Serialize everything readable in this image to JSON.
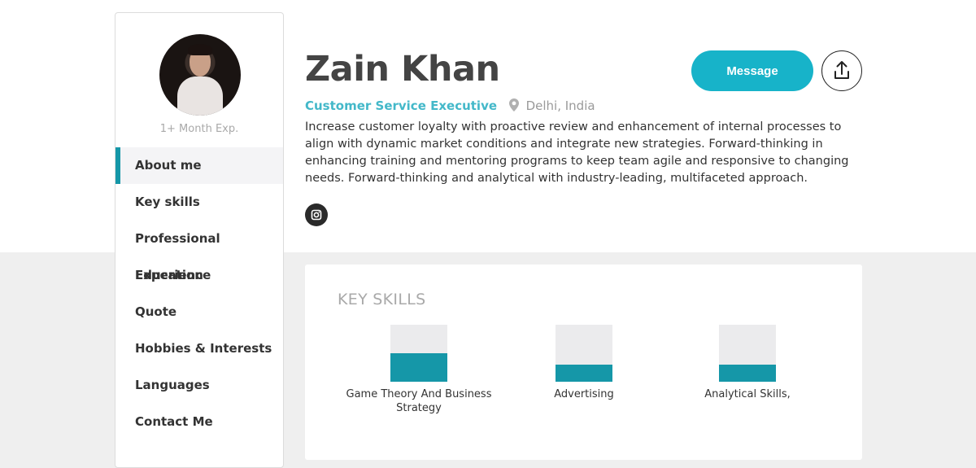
{
  "profile": {
    "name": "Zain Khan",
    "role": "Customer Service Executive",
    "location": "Delhi, India",
    "experience": "1+ Month Exp.",
    "bio": "Increase customer loyalty with proactive review and enhancement of internal processes to align with dynamic market conditions and integrate new strategies. Forward-thinking in enhancing training and mentoring programs to keep team agile and responsive to changing needs. Forward-thinking and analytical with industry-leading, multifaceted approach."
  },
  "actions": {
    "message_label": "Message"
  },
  "sidebar": {
    "items": [
      {
        "label": "About me",
        "active": true
      },
      {
        "label": "Key skills"
      },
      {
        "label": "Professional Experience"
      },
      {
        "label": "Education"
      },
      {
        "label": "Quote"
      },
      {
        "label": "Hobbies & Interests"
      },
      {
        "label": "Languages"
      },
      {
        "label": "Contact Me"
      }
    ]
  },
  "skills_section": {
    "title": "KEY SKILLS",
    "skills": [
      {
        "label": "Game Theory And Business Strategy",
        "level": 0.5
      },
      {
        "label": "Advertising",
        "level": 0.3
      },
      {
        "label": "Analytical Skills,",
        "level": 0.3
      }
    ]
  },
  "icons": {
    "location": "location-pin-icon",
    "social": "instagram-icon",
    "share": "share-icon"
  },
  "colors": {
    "accent": "#17b3c9",
    "bar_fill": "#1597a8",
    "bar_track": "#ebebed"
  }
}
